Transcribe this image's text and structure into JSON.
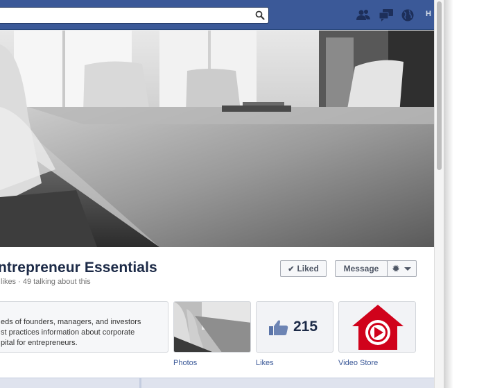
{
  "topbar": {
    "search_value": "",
    "search_placeholder": "",
    "home_label": "H"
  },
  "page": {
    "title": "ntrepreneur Essentials",
    "stats": " likes · 49 talking about this"
  },
  "actions": {
    "liked_label": "Liked",
    "message_label": "Message"
  },
  "about": {
    "lines": [
      "eds of founders, managers, and investors",
      "st practices information about corporate",
      "pital for entrepreneurs."
    ]
  },
  "apps": [
    {
      "label": "Photos"
    },
    {
      "label": "Likes",
      "count": "215"
    },
    {
      "label": "Video Store"
    }
  ],
  "colors": {
    "brand_blue": "#3b5998",
    "video_red": "#d0021b",
    "title_text": "#1c2a47"
  },
  "icons": [
    "search-icon",
    "friend-requests-icon",
    "messages-icon",
    "notifications-globe-icon",
    "check-icon",
    "gear-icon",
    "caret-down-icon",
    "thumbs-up-icon",
    "video-store-house-icon"
  ]
}
